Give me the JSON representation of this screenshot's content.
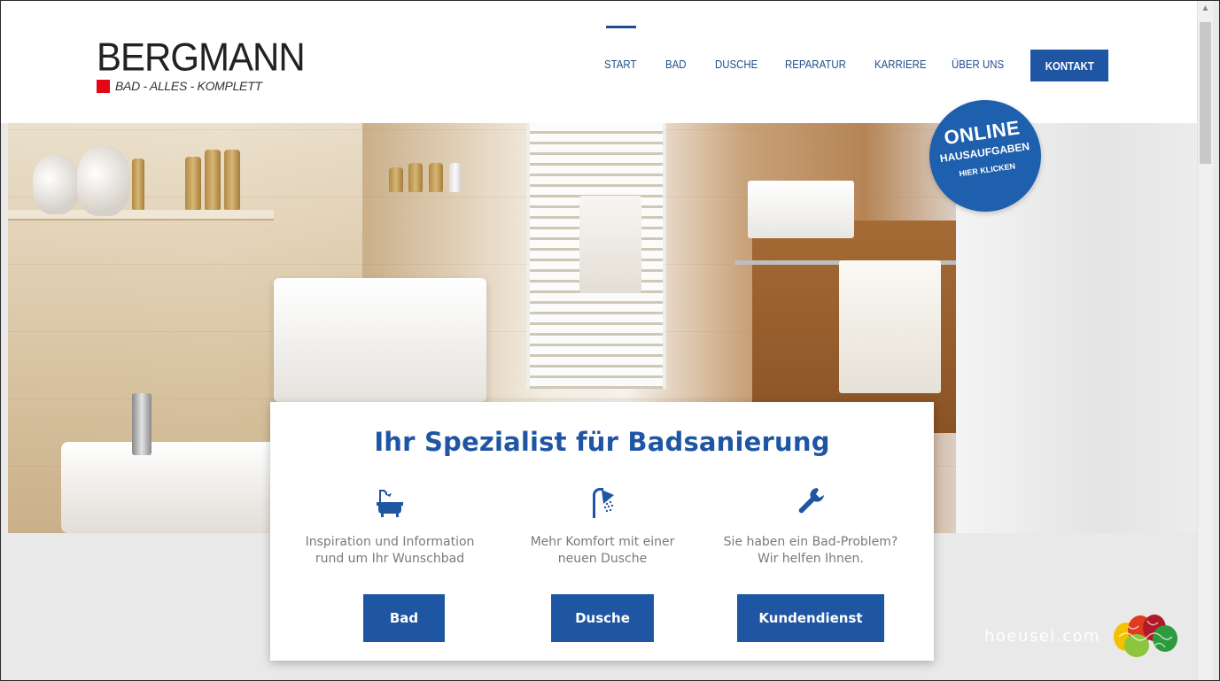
{
  "logo": {
    "word": "BERGMANN",
    "tagline": "BAD - ALLES - KOMPLETT",
    "accent": "#e30613"
  },
  "nav": {
    "items": [
      {
        "label": "START",
        "active": true
      },
      {
        "label": "BAD"
      },
      {
        "label": "DUSCHE"
      },
      {
        "label": "REPARATUR"
      },
      {
        "label": "KARRIERE"
      },
      {
        "label": "ÜBER UNS"
      }
    ],
    "cta": "KONTAKT"
  },
  "badge": {
    "line1": "ONLINE",
    "line2": "HAUSAUFGABEN",
    "line3": "HIER KLICKEN"
  },
  "card": {
    "title": "Ihr Spezialist für Badsanierung",
    "columns": [
      {
        "icon": "bathtub-icon",
        "text_line1": "Inspiration und Information",
        "text_line2": "rund um Ihr Wunschbad",
        "button": "Bad"
      },
      {
        "icon": "shower-icon",
        "text_line1": "Mehr Komfort mit einer",
        "text_line2": "neuen Dusche",
        "button": "Dusche"
      },
      {
        "icon": "wrench-icon",
        "text_line1": "Sie haben ein Bad-Problem?",
        "text_line2": "Wir helfen Ihnen.",
        "button": "Kundendienst"
      }
    ]
  },
  "watermark": "hoeusel.com",
  "colors": {
    "brand_blue": "#1f56a4",
    "nav_text": "#1f4e8c",
    "badge_blue": "#1e5fae"
  }
}
